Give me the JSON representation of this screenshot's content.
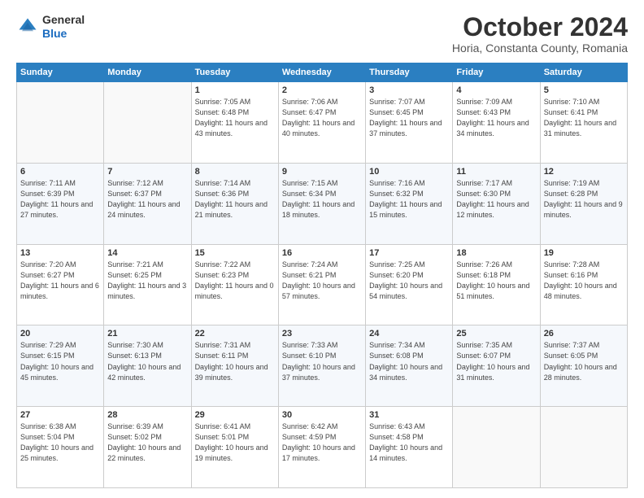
{
  "header": {
    "logo": {
      "general": "General",
      "blue": "Blue"
    },
    "title": "October 2024",
    "location": "Horia, Constanta County, Romania"
  },
  "days_of_week": [
    "Sunday",
    "Monday",
    "Tuesday",
    "Wednesday",
    "Thursday",
    "Friday",
    "Saturday"
  ],
  "weeks": [
    [
      {
        "num": "",
        "info": ""
      },
      {
        "num": "",
        "info": ""
      },
      {
        "num": "1",
        "info": "Sunrise: 7:05 AM\nSunset: 6:48 PM\nDaylight: 11 hours and 43 minutes."
      },
      {
        "num": "2",
        "info": "Sunrise: 7:06 AM\nSunset: 6:47 PM\nDaylight: 11 hours and 40 minutes."
      },
      {
        "num": "3",
        "info": "Sunrise: 7:07 AM\nSunset: 6:45 PM\nDaylight: 11 hours and 37 minutes."
      },
      {
        "num": "4",
        "info": "Sunrise: 7:09 AM\nSunset: 6:43 PM\nDaylight: 11 hours and 34 minutes."
      },
      {
        "num": "5",
        "info": "Sunrise: 7:10 AM\nSunset: 6:41 PM\nDaylight: 11 hours and 31 minutes."
      }
    ],
    [
      {
        "num": "6",
        "info": "Sunrise: 7:11 AM\nSunset: 6:39 PM\nDaylight: 11 hours and 27 minutes."
      },
      {
        "num": "7",
        "info": "Sunrise: 7:12 AM\nSunset: 6:37 PM\nDaylight: 11 hours and 24 minutes."
      },
      {
        "num": "8",
        "info": "Sunrise: 7:14 AM\nSunset: 6:36 PM\nDaylight: 11 hours and 21 minutes."
      },
      {
        "num": "9",
        "info": "Sunrise: 7:15 AM\nSunset: 6:34 PM\nDaylight: 11 hours and 18 minutes."
      },
      {
        "num": "10",
        "info": "Sunrise: 7:16 AM\nSunset: 6:32 PM\nDaylight: 11 hours and 15 minutes."
      },
      {
        "num": "11",
        "info": "Sunrise: 7:17 AM\nSunset: 6:30 PM\nDaylight: 11 hours and 12 minutes."
      },
      {
        "num": "12",
        "info": "Sunrise: 7:19 AM\nSunset: 6:28 PM\nDaylight: 11 hours and 9 minutes."
      }
    ],
    [
      {
        "num": "13",
        "info": "Sunrise: 7:20 AM\nSunset: 6:27 PM\nDaylight: 11 hours and 6 minutes."
      },
      {
        "num": "14",
        "info": "Sunrise: 7:21 AM\nSunset: 6:25 PM\nDaylight: 11 hours and 3 minutes."
      },
      {
        "num": "15",
        "info": "Sunrise: 7:22 AM\nSunset: 6:23 PM\nDaylight: 11 hours and 0 minutes."
      },
      {
        "num": "16",
        "info": "Sunrise: 7:24 AM\nSunset: 6:21 PM\nDaylight: 10 hours and 57 minutes."
      },
      {
        "num": "17",
        "info": "Sunrise: 7:25 AM\nSunset: 6:20 PM\nDaylight: 10 hours and 54 minutes."
      },
      {
        "num": "18",
        "info": "Sunrise: 7:26 AM\nSunset: 6:18 PM\nDaylight: 10 hours and 51 minutes."
      },
      {
        "num": "19",
        "info": "Sunrise: 7:28 AM\nSunset: 6:16 PM\nDaylight: 10 hours and 48 minutes."
      }
    ],
    [
      {
        "num": "20",
        "info": "Sunrise: 7:29 AM\nSunset: 6:15 PM\nDaylight: 10 hours and 45 minutes."
      },
      {
        "num": "21",
        "info": "Sunrise: 7:30 AM\nSunset: 6:13 PM\nDaylight: 10 hours and 42 minutes."
      },
      {
        "num": "22",
        "info": "Sunrise: 7:31 AM\nSunset: 6:11 PM\nDaylight: 10 hours and 39 minutes."
      },
      {
        "num": "23",
        "info": "Sunrise: 7:33 AM\nSunset: 6:10 PM\nDaylight: 10 hours and 37 minutes."
      },
      {
        "num": "24",
        "info": "Sunrise: 7:34 AM\nSunset: 6:08 PM\nDaylight: 10 hours and 34 minutes."
      },
      {
        "num": "25",
        "info": "Sunrise: 7:35 AM\nSunset: 6:07 PM\nDaylight: 10 hours and 31 minutes."
      },
      {
        "num": "26",
        "info": "Sunrise: 7:37 AM\nSunset: 6:05 PM\nDaylight: 10 hours and 28 minutes."
      }
    ],
    [
      {
        "num": "27",
        "info": "Sunrise: 6:38 AM\nSunset: 5:04 PM\nDaylight: 10 hours and 25 minutes."
      },
      {
        "num": "28",
        "info": "Sunrise: 6:39 AM\nSunset: 5:02 PM\nDaylight: 10 hours and 22 minutes."
      },
      {
        "num": "29",
        "info": "Sunrise: 6:41 AM\nSunset: 5:01 PM\nDaylight: 10 hours and 19 minutes."
      },
      {
        "num": "30",
        "info": "Sunrise: 6:42 AM\nSunset: 4:59 PM\nDaylight: 10 hours and 17 minutes."
      },
      {
        "num": "31",
        "info": "Sunrise: 6:43 AM\nSunset: 4:58 PM\nDaylight: 10 hours and 14 minutes."
      },
      {
        "num": "",
        "info": ""
      },
      {
        "num": "",
        "info": ""
      }
    ]
  ]
}
